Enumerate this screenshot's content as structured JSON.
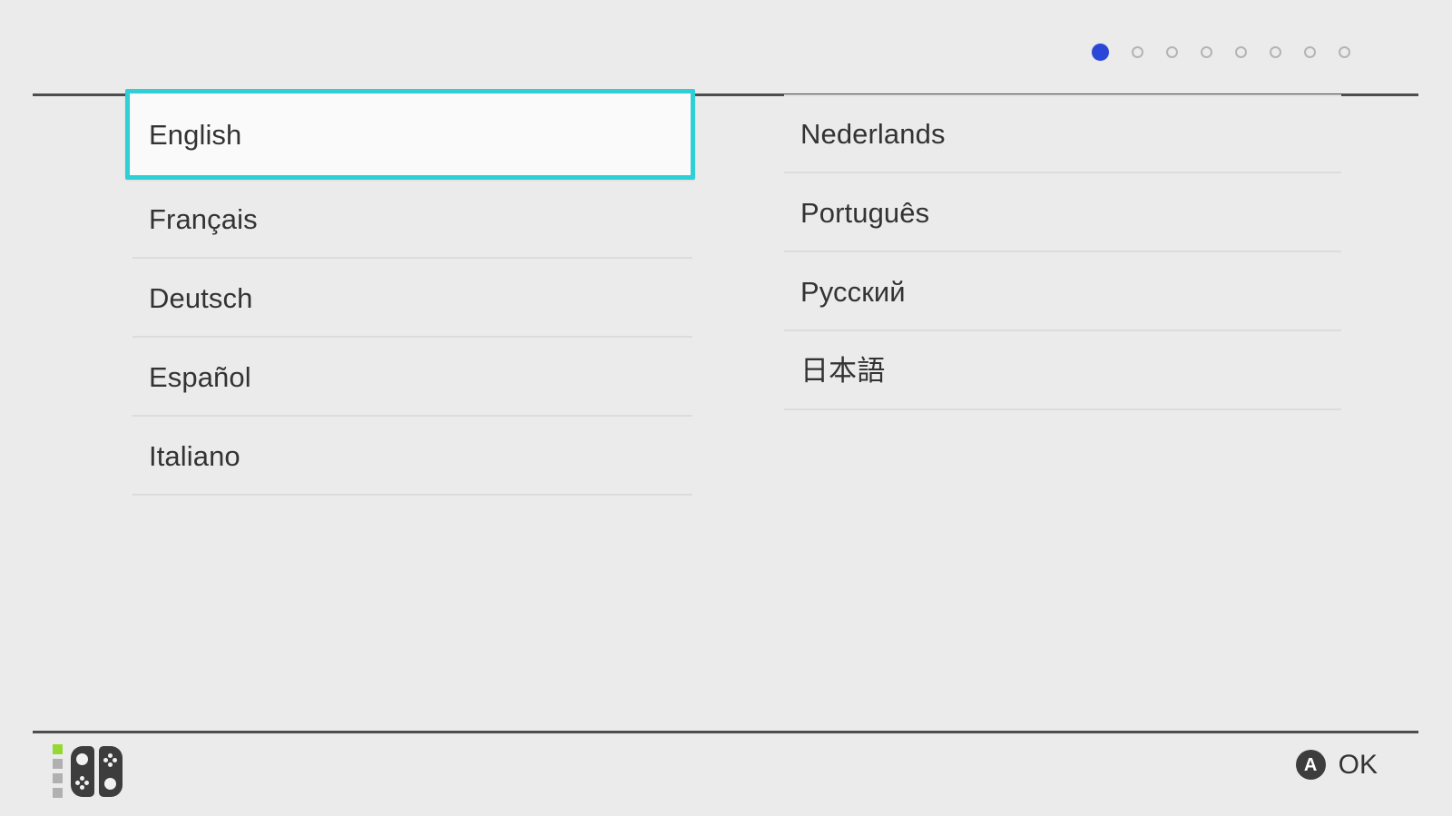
{
  "screen": {
    "name": "language-selection",
    "background_color": "#ebebeb",
    "accent_color": "#2ecfd6",
    "active_dot_color": "#2a47d8"
  },
  "header": {
    "pagination": {
      "total_steps": 8,
      "current_step": 1,
      "dots": [
        {
          "active": true
        },
        {
          "active": false
        },
        {
          "active": false
        },
        {
          "active": false
        },
        {
          "active": false
        },
        {
          "active": false
        },
        {
          "active": false
        },
        {
          "active": false
        }
      ]
    }
  },
  "main": {
    "selected_language": "English",
    "columns": [
      {
        "name": "left-column",
        "items": [
          {
            "label": "English",
            "selected": true
          },
          {
            "label": "Français",
            "selected": false
          },
          {
            "label": "Deutsch",
            "selected": false
          },
          {
            "label": "Español",
            "selected": false
          },
          {
            "label": "Italiano",
            "selected": false
          }
        ]
      },
      {
        "name": "right-column",
        "items": [
          {
            "label": "Nederlands",
            "selected": false
          },
          {
            "label": "Português",
            "selected": false
          },
          {
            "label": "Русский",
            "selected": false
          },
          {
            "label": "日本語",
            "selected": false
          }
        ]
      }
    ]
  },
  "footer": {
    "controller": {
      "icon": "joycon-pair-icon",
      "player_leds": [
        {
          "on": true
        },
        {
          "on": false
        },
        {
          "on": false
        },
        {
          "on": false
        }
      ]
    },
    "action": {
      "button_glyph": "A",
      "label": "OK"
    }
  }
}
